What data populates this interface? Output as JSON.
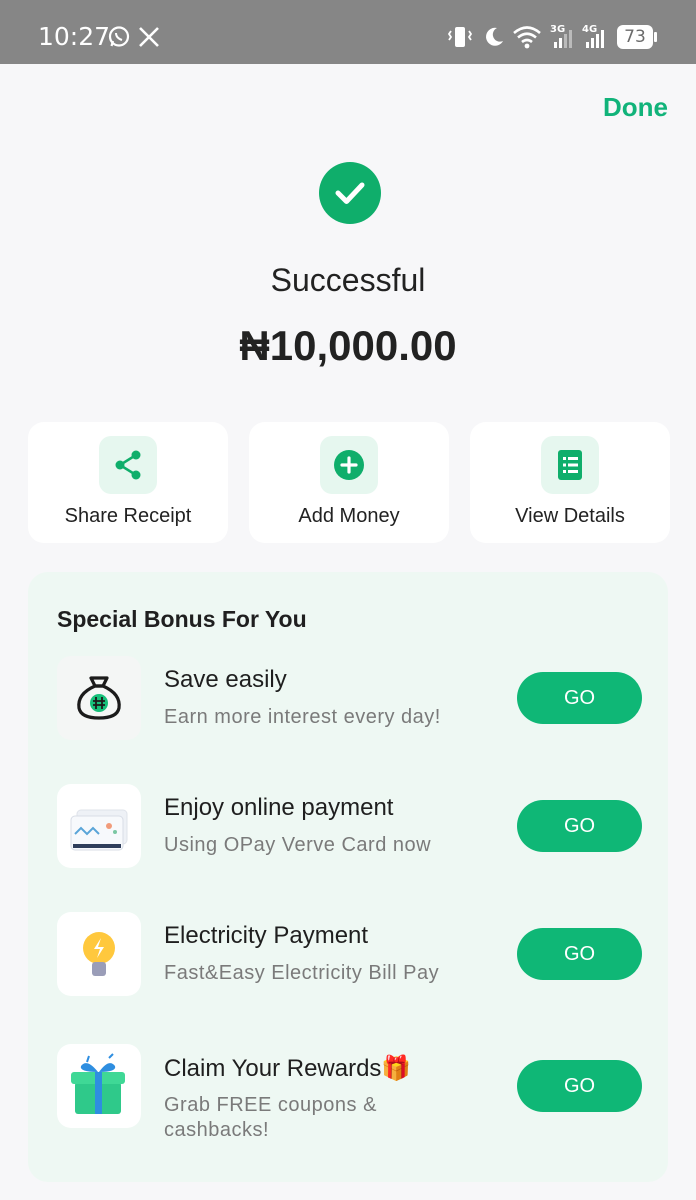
{
  "status_bar": {
    "time": "10:27",
    "battery": "73"
  },
  "header": {
    "done_label": "Done"
  },
  "result": {
    "status": "Successful",
    "amount": "₦10,000.00"
  },
  "actions": [
    {
      "label": "Share Receipt",
      "icon": "share-icon"
    },
    {
      "label": "Add Money",
      "icon": "plus-circle-icon"
    },
    {
      "label": "View Details",
      "icon": "document-list-icon"
    }
  ],
  "bonus": {
    "title": "Special Bonus For You",
    "items": [
      {
        "name": "Save easily",
        "description": "Earn more interest every day!",
        "button": "GO",
        "icon": "money-bag-icon"
      },
      {
        "name": "Enjoy online payment",
        "description": "Using OPay Verve Card now",
        "button": "GO",
        "icon": "card-icon"
      },
      {
        "name": "Electricity Payment",
        "description": "Fast&Easy Electricity Bill Pay",
        "button": "GO",
        "icon": "lightbulb-icon"
      },
      {
        "name": "Claim Your Rewards🎁",
        "description": "Grab FREE coupons & cashbacks!",
        "button": "GO",
        "icon": "gift-box-icon"
      }
    ]
  },
  "colors": {
    "accent": "#0fb776",
    "done": "#11b37a",
    "panel": "#eef8f3",
    "status_bar": "#868686"
  }
}
